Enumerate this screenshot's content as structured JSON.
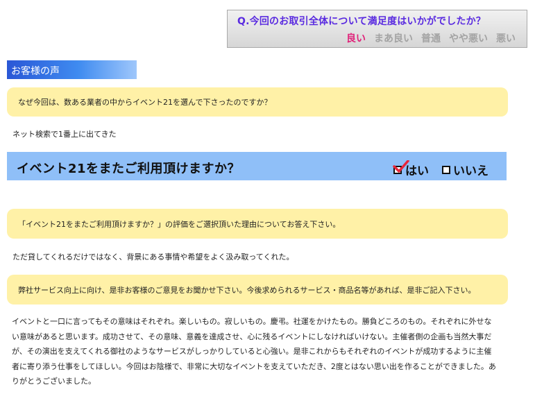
{
  "survey": {
    "question": "Q.今回のお取引全体について満足度はいかがでしたか？",
    "ratings": [
      "良い",
      "まあ良い",
      "普通",
      "やや悪い",
      "悪い"
    ],
    "selected": "良い",
    "selected_color": "#e0237a"
  },
  "voice_header": "お客様の声",
  "q1": {
    "question": "なぜ今回は、数ある業者の中からイベント21を選んで下さったのですか？",
    "answer": "ネット検索で1番上に出てきた"
  },
  "reuse": {
    "title": "イベント21をまたご利用頂けますか？",
    "yes": "はい",
    "no": "いいえ",
    "selected": "はい",
    "check_icon": "check-icon"
  },
  "q2": {
    "question": "「イベント21をまたご利用頂けますか？」の評価をご選択頂いた理由についてお答え下さい。",
    "answer": "ただ貸してくれるだけではなく、背景にある事情や希望をよく汲み取ってくれた。"
  },
  "q3": {
    "question": "弊社サービス向上に向け、是非お客様のご意見をお聞かせ下さい。今後求められるサービス・商品名等があれば、是非ご記入下さい。",
    "answer": "イベントと一口に言ってもその意味はそれぞれ。楽しいもの。寂しいもの。慶弔。社運をかけたもの。勝負どころのもの。それぞれに外せない意味があると思います。成功させて、その意味、意義を達成させ、心に残るイベントにしなければいけない。主催者側の企画も当然大事だが、その演出を支えてくれる御社のようなサービスがしっかりしていると心強い。是非これからもそれぞれのイベントが成功するように主催者に寄り添う仕事をしてほしい。今回はお陰様で、非常に大切なイベントを支えていただき、2度とはない思い出を作ることができました。ありがとうございました。"
  }
}
